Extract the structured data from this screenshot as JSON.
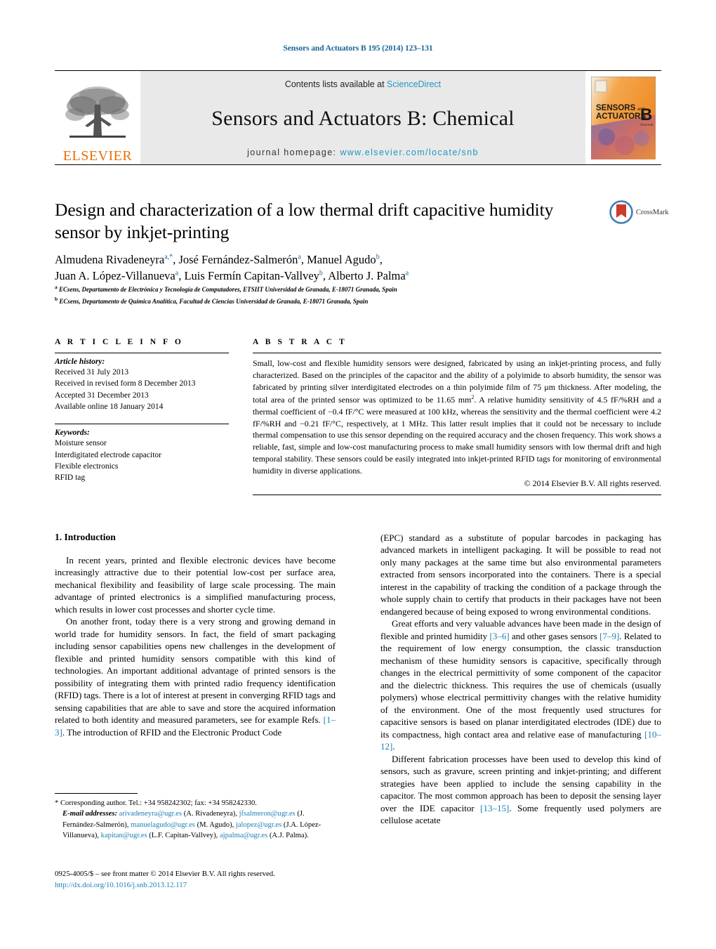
{
  "running_head": "Sensors and Actuators B 195 (2014) 123–131",
  "masthead": {
    "publisher_logo_label": "ELSEVIER",
    "contents_prefix": "Contents lists available at ",
    "contents_link": "ScienceDirect",
    "journal_title": "Sensors and Actuators B: Chemical",
    "homepage_prefix": "journal homepage: ",
    "homepage_url": "www.elsevier.com/locate/snb",
    "cover_title_line1": "SENSORS",
    "cover_title_and": "and",
    "cover_title_line2": "ACTUATORS",
    "cover_letter": "B",
    "cover_sub": "Chemical"
  },
  "article": {
    "title": "Design and characterization of a low thermal drift capacitive humidity sensor by inkjet-printing",
    "crossmark_label": "CrossMark",
    "authors_line1": "Almudena Rivadeneyra",
    "authors_line1_sup1": "a,*",
    "authors_line1_b": ", José Fernández-Salmerón",
    "authors_line1_sup2": "a",
    "authors_line1_c": ", Manuel Agudo",
    "authors_line1_sup3": "b",
    "authors_line1_d": ",",
    "authors_line2": "Juan A. López-Villanueva",
    "authors_line2_sup1": "a",
    "authors_line2_b": ", Luis Fermín Capitan-Vallvey",
    "authors_line2_sup2": "b",
    "authors_line2_c": ", Alberto J. Palma",
    "authors_line2_sup3": "a",
    "affiliation_a_sup": "a",
    "affiliation_a": "ECsens, Departamento de Electrónica y Tecnología de Computadores, ETSIIT Universidad de Granada, E-18071 Granada, Spain",
    "affiliation_b_sup": "b",
    "affiliation_b": "ECsens, Departamento de Química Analítica, Facultad de Ciencias Universidad de Granada, E-18071 Granada, Spain"
  },
  "article_info": {
    "heading": "A R T I C L E    I N F O",
    "history_label": "Article history:",
    "history": [
      "Received 31 July 2013",
      "Received in revised form 8 December 2013",
      "Accepted 31 December 2013",
      "Available online 18 January 2014"
    ],
    "keywords_label": "Keywords:",
    "keywords": [
      "Moisture sensor",
      "Interdigitated electrode capacitor",
      "Flexible electronics",
      "RFID tag"
    ]
  },
  "abstract": {
    "heading": "A B S T R A C T",
    "part1": "Small, low-cost and flexible humidity sensors were designed, fabricated by using an inkjet-printing process, and fully characterized. Based on the principles of the capacitor and the ability of a polyimide to absorb humidity, the sensor was fabricated by printing silver interdigitated electrodes on a thin polyimide film of 75 μm thickness. After modeling, the total area of the printed sensor was optimized to be 11.65 mm",
    "sup": "2",
    "part2": ". A relative humidity sensitivity of 4.5 fF/%RH and a thermal coefficient of −0.4 fF/°C were measured at 100 kHz, whereas the sensitivity and the thermal coefficient were 4.2 fF/%RH and −0.21 fF/°C, respectively, at 1 MHz. This latter result implies that it could not be necessary to include thermal compensation to use this sensor depending on the required accuracy and the chosen frequency. This work shows a reliable, fast, simple and low-cost manufacturing process to make small humidity sensors with low thermal drift and high temporal stability. These sensors could be easily integrated into inkjet-printed RFID tags for monitoring of environmental humidity in diverse applications.",
    "copyright": "© 2014 Elsevier B.V. All rights reserved."
  },
  "body": {
    "section_title": "1. Introduction",
    "left_para1": "In recent years, printed and flexible electronic devices have become increasingly attractive due to their potential low-cost per surface area, mechanical flexibility and feasibility of large scale processing. The main advantage of printed electronics is a simplified manufacturing process, which results in lower cost processes and shorter cycle time.",
    "left_para2_a": "On another front, today there is a very strong and growing demand in world trade for humidity sensors. In fact, the field of smart packaging including sensor capabilities opens new challenges in the development of flexible and printed humidity sensors compatible with this kind of technologies. An important additional advantage of printed sensors is the possibility of integrating them with printed radio frequency identification (RFID) tags. There is a lot of interest at present in converging RFID tags and sensing capabilities that are able to save and store the acquired information related to both identity and measured parameters, see for example Refs. ",
    "left_para2_ref": "[1–3]",
    "left_para2_b": ". The introduction of RFID and the Electronic Product Code",
    "right_para1": "(EPC) standard as a substitute of popular barcodes in packaging has advanced markets in intelligent packaging. It will be possible to read not only many packages at the same time but also environmental parameters extracted from sensors incorporated into the containers. There is a special interest in the capability of tracking the condition of a package through the whole supply chain to certify that products in their packages have not been endangered because of being exposed to wrong environmental conditions.",
    "right_para2_a": "Great efforts and very valuable advances have been made in the design of flexible and printed humidity ",
    "right_para2_ref1": "[3–6]",
    "right_para2_b": " and other gases sensors ",
    "right_para2_ref2": "[7–9]",
    "right_para2_c": ". Related to the requirement of low energy consumption, the classic transduction mechanism of these humidity sensors is capacitive, specifically through changes in the electrical permittivity of some component of the capacitor and the dielectric thickness. This requires the use of chemicals (usually polymers) whose electrical permittivity changes with the relative humidity of the environment. One of the most frequently used structures for capacitive sensors is based on planar interdigitated electrodes (IDE) due to its compactness, high contact area and relative ease of manufacturing ",
    "right_para2_ref3": "[10–12]",
    "right_para2_d": ".",
    "right_para3_a": "Different fabrication processes have been used to develop this kind of sensors, such as gravure, screen printing and inkjet-printing; and different strategies have been applied to include the sensing capability in the capacitor. The most common approach has been to deposit the sensing layer over the IDE capacitor ",
    "right_para3_ref": "[13–15]",
    "right_para3_b": ". Some frequently used polymers are cellulose acetate"
  },
  "footnotes": {
    "corresponding_marker": "*",
    "corresponding": "Corresponding author. Tel.: +34 958242302; fax: +34 958242330.",
    "email_label": "E-mail addresses:",
    "emails": [
      {
        "address": "arivadeneyra@ugr.es",
        "name": "(A. Rivadeneyra)"
      },
      {
        "address": "jfsalmeron@ugr.es",
        "name": "(J. Fernández-Salmerón)"
      },
      {
        "address": "manuelagudo@ugr.es",
        "name": "(M. Agudo)"
      },
      {
        "address": "jalopez@ugr.es",
        "name": "(J.A. López-Villanueva)"
      },
      {
        "address": "kapitan@ugr.es",
        "name": "(L.F. Capitan-Vallvey)"
      },
      {
        "address": "ajpalma@ugr.es",
        "name": "(A.J. Palma)."
      }
    ]
  },
  "imprint": {
    "issn_line": "0925-4005/$ – see front matter © 2014 Elsevier B.V. All rights reserved.",
    "doi": "http://dx.doi.org/10.1016/j.snb.2013.12.117"
  },
  "colors": {
    "link": "#1a7fb5",
    "header_blue": "#1a6496",
    "elsevier_orange": "#E8700A",
    "band_gray": "#e9e9e9"
  }
}
